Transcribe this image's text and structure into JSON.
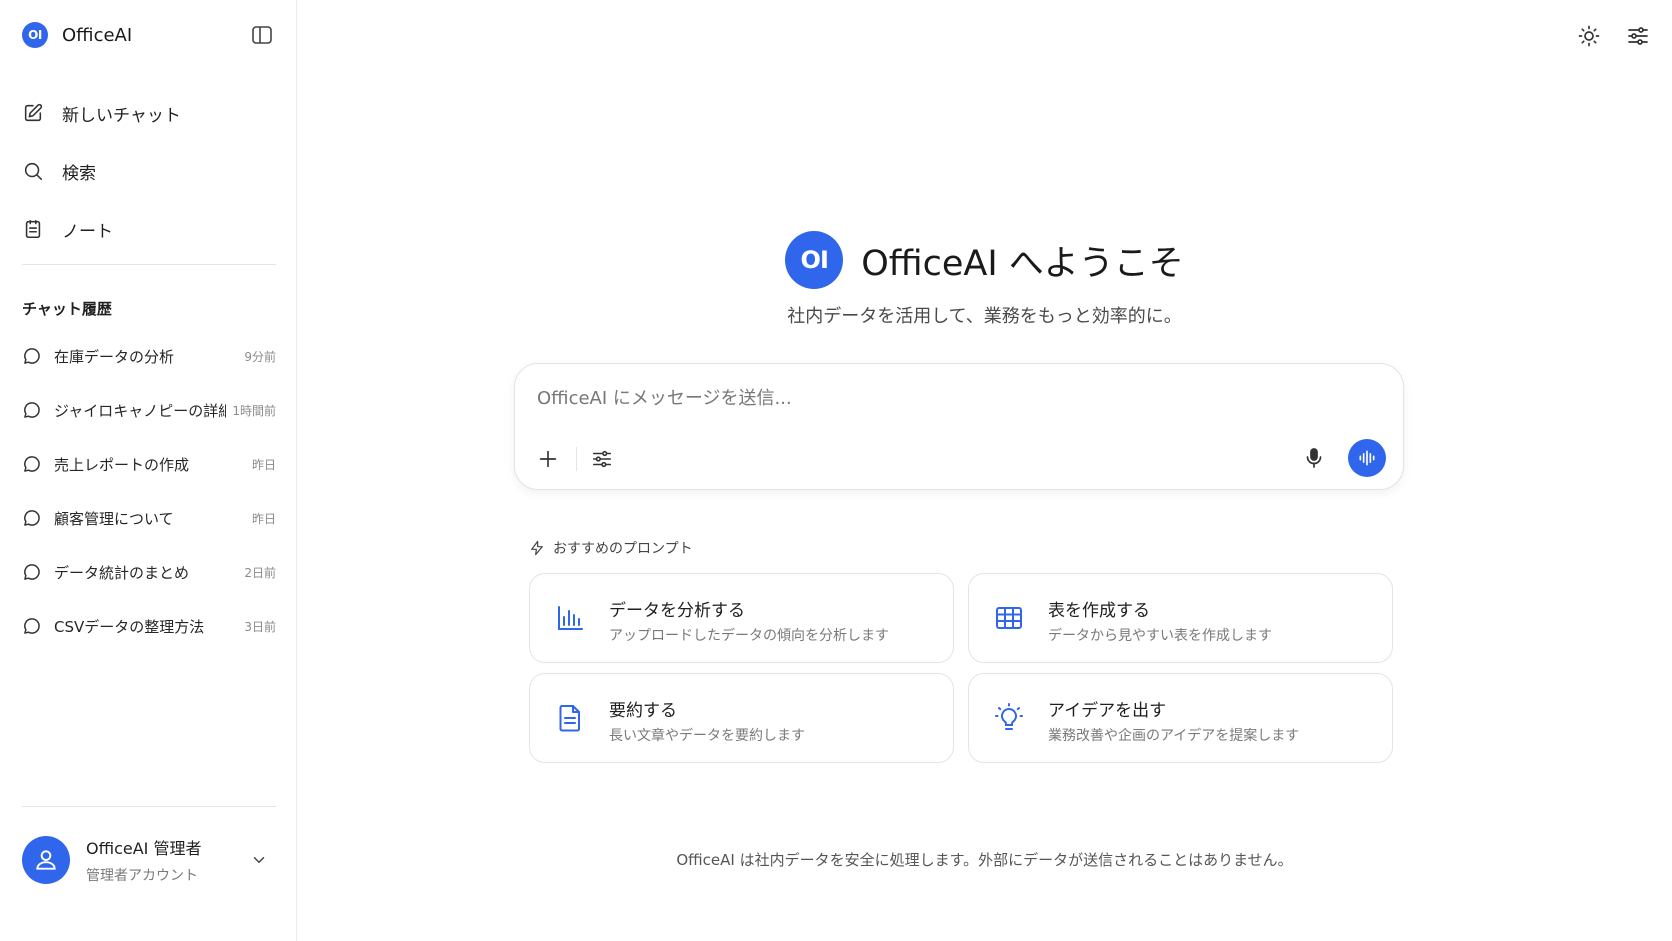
{
  "brand": {
    "name": "OfficeAI",
    "logo_text": "OI"
  },
  "nav": [
    {
      "label": "新しいチャット",
      "icon": "edit-icon"
    },
    {
      "label": "検索",
      "icon": "search-icon"
    },
    {
      "label": "ノート",
      "icon": "note-icon"
    }
  ],
  "history": {
    "title": "チャット履歴",
    "items": [
      {
        "label": "在庫データの分析",
        "time": "9分前"
      },
      {
        "label": "ジャイロキャノピーの詳細",
        "time": "1時間前"
      },
      {
        "label": "売上レポートの作成",
        "time": "昨日"
      },
      {
        "label": "顧客管理について",
        "time": "昨日"
      },
      {
        "label": "データ統計のまとめ",
        "time": "2日前"
      },
      {
        "label": "CSVデータの整理方法",
        "time": "3日前"
      }
    ]
  },
  "user": {
    "name": "OfficeAI 管理者",
    "role": "管理者アカウント"
  },
  "hero": {
    "logo_text": "OI",
    "title": "OfficeAI へようこそ",
    "subtitle": "社内データを活用して、業務をもっと効率的に。"
  },
  "composer": {
    "placeholder": "OfficeAI にメッセージを送信..."
  },
  "recommend": {
    "title": "おすすめのプロンプト",
    "cards": [
      {
        "title": "データを分析する",
        "desc": "アップロードしたデータの傾向を分析します",
        "icon": "bar-chart-icon"
      },
      {
        "title": "表を作成する",
        "desc": "データから見やすい表を作成します",
        "icon": "table-icon"
      },
      {
        "title": "要約する",
        "desc": "長い文章やデータを要約します",
        "icon": "document-icon"
      },
      {
        "title": "アイデアを出す",
        "desc": "業務改善や企画のアイデアを提案します",
        "icon": "lightbulb-icon"
      }
    ]
  },
  "footer": {
    "note": "OfficeAI は社内データを安全に処理します。外部にデータが送信されることはありません。"
  },
  "colors": {
    "accent": "#2f66eb",
    "border": "#e4e4e4",
    "muted": "#7a7a7a"
  }
}
